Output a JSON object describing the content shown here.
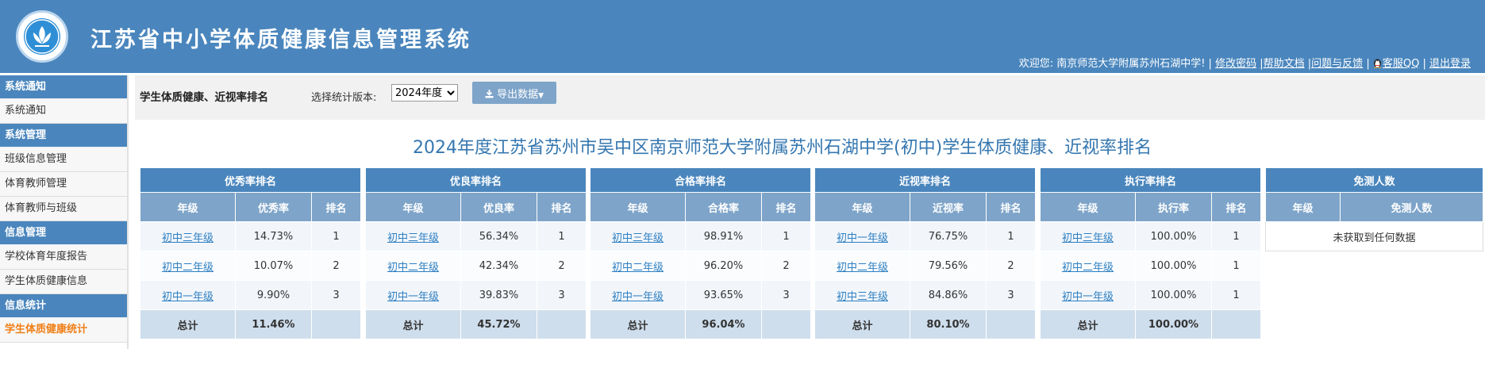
{
  "header": {
    "title": "江苏省中小学体质健康信息管理系统",
    "welcome_prefix": "欢迎您: 南京师范大学附属苏州石湖中学! |",
    "links": [
      "修改密码",
      "|帮助文档",
      "|问题与反馈",
      "|",
      "客服QQ",
      "|",
      "退出登录"
    ]
  },
  "sidebar": {
    "sections": [
      {
        "title": "系统通知",
        "items": [
          {
            "label": "系统通知"
          }
        ]
      },
      {
        "title": "系统管理",
        "items": [
          {
            "label": "班级信息管理"
          },
          {
            "label": "体育教师管理"
          },
          {
            "label": "体育教师与班级"
          }
        ]
      },
      {
        "title": "信息管理",
        "items": [
          {
            "label": "学校体育年度报告"
          },
          {
            "label": "学生体质健康信息"
          }
        ]
      },
      {
        "title": "信息统计",
        "items": [
          {
            "label": "学生体质健康统计"
          }
        ]
      }
    ],
    "active": "学生体质健康统计"
  },
  "toolbar": {
    "heading": "学生体质健康、近视率排名",
    "version_label": "选择统计版本:",
    "version_value": "2024年度",
    "export_label": "导出数据"
  },
  "report": {
    "title": "2024年度江苏省苏州市吴中区南京师范大学附属苏州石湖中学(初中)学生体质健康、近视率排名",
    "tables": [
      {
        "caption": "优秀率排名",
        "headers": [
          "年级",
          "优秀率",
          "排名"
        ],
        "rows": [
          [
            "初中三年级",
            "14.73%",
            "1"
          ],
          [
            "初中二年级",
            "10.07%",
            "2"
          ],
          [
            "初中一年级",
            "9.90%",
            "3"
          ]
        ],
        "total": [
          "总计",
          "11.46%",
          ""
        ]
      },
      {
        "caption": "优良率排名",
        "headers": [
          "年级",
          "优良率",
          "排名"
        ],
        "rows": [
          [
            "初中三年级",
            "56.34%",
            "1"
          ],
          [
            "初中二年级",
            "42.34%",
            "2"
          ],
          [
            "初中一年级",
            "39.83%",
            "3"
          ]
        ],
        "total": [
          "总计",
          "45.72%",
          ""
        ]
      },
      {
        "caption": "合格率排名",
        "headers": [
          "年级",
          "合格率",
          "排名"
        ],
        "rows": [
          [
            "初中三年级",
            "98.91%",
            "1"
          ],
          [
            "初中二年级",
            "96.20%",
            "2"
          ],
          [
            "初中一年级",
            "93.65%",
            "3"
          ]
        ],
        "total": [
          "总计",
          "96.04%",
          ""
        ]
      },
      {
        "caption": "近视率排名",
        "headers": [
          "年级",
          "近视率",
          "排名"
        ],
        "rows": [
          [
            "初中一年级",
            "76.75%",
            "1"
          ],
          [
            "初中二年级",
            "79.56%",
            "2"
          ],
          [
            "初中三年级",
            "84.86%",
            "3"
          ]
        ],
        "total": [
          "总计",
          "80.10%",
          ""
        ]
      },
      {
        "caption": "执行率排名",
        "headers": [
          "年级",
          "执行率",
          "排名"
        ],
        "rows": [
          [
            "初中三年级",
            "100.00%",
            "1"
          ],
          [
            "初中二年级",
            "100.00%",
            "1"
          ],
          [
            "初中一年级",
            "100.00%",
            "1"
          ]
        ],
        "total": [
          "总计",
          "100.00%",
          ""
        ]
      }
    ],
    "exempt": {
      "caption": "免测人数",
      "headers": [
        "年级",
        "免测人数"
      ],
      "empty_text": "未获取到任何数据"
    }
  },
  "colors": {
    "header_bg": "#4a86bd",
    "table_head": "#7ea4c9",
    "link": "#2e7fc1",
    "active": "#f07f17",
    "title": "#3577b0"
  }
}
